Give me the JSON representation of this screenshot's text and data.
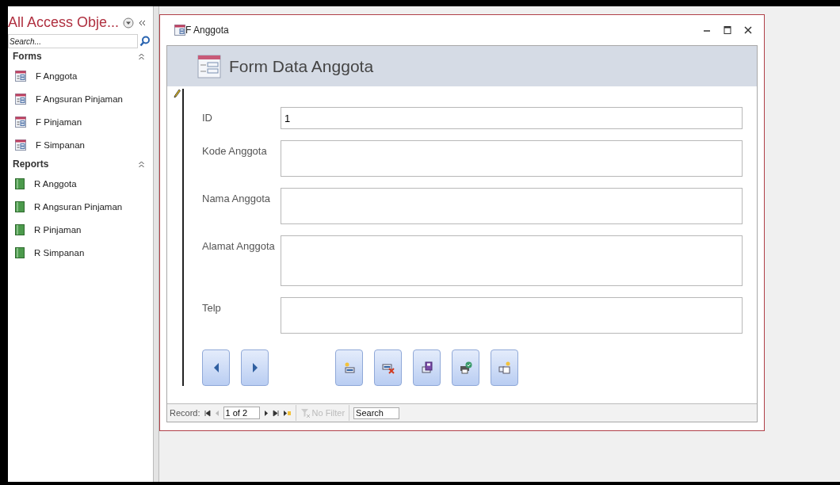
{
  "nav_pane": {
    "title": "All Access Obje...",
    "search": {
      "placeholder": "Search..."
    },
    "groups": [
      {
        "label": "Forms",
        "kind": "form",
        "expanded": true,
        "items": [
          "F Anggota",
          "F Angsuran Pinjaman",
          "F Pinjaman",
          "F Simpanan"
        ]
      },
      {
        "label": "Reports",
        "kind": "report",
        "expanded": true,
        "items": [
          "R Anggota",
          "R Angsuran Pinjaman",
          "R Pinjaman",
          "R Simpanan"
        ]
      }
    ]
  },
  "window": {
    "title": "F Anggota",
    "header": "Form Data Anggota",
    "editing": true,
    "fields": [
      {
        "label": "ID",
        "value": "1",
        "kind": "single"
      },
      {
        "label": "Kode Anggota",
        "kind": "double"
      },
      {
        "label": "Nama Anggota",
        "kind": "double"
      },
      {
        "label": "Alamat Anggota",
        "kind": "triple"
      },
      {
        "label": "Telp",
        "kind": "double"
      }
    ],
    "buttons": [
      {
        "kind": "previous"
      },
      {
        "kind": "next"
      },
      {
        "kind": "new"
      },
      {
        "kind": "delete"
      },
      {
        "kind": "save"
      },
      {
        "kind": "print"
      },
      {
        "kind": "copy"
      }
    ],
    "record_bar": {
      "label": "Record:",
      "position": "1 of 2",
      "filter": "No Filter",
      "search": {
        "placeholder": "Search"
      }
    }
  }
}
